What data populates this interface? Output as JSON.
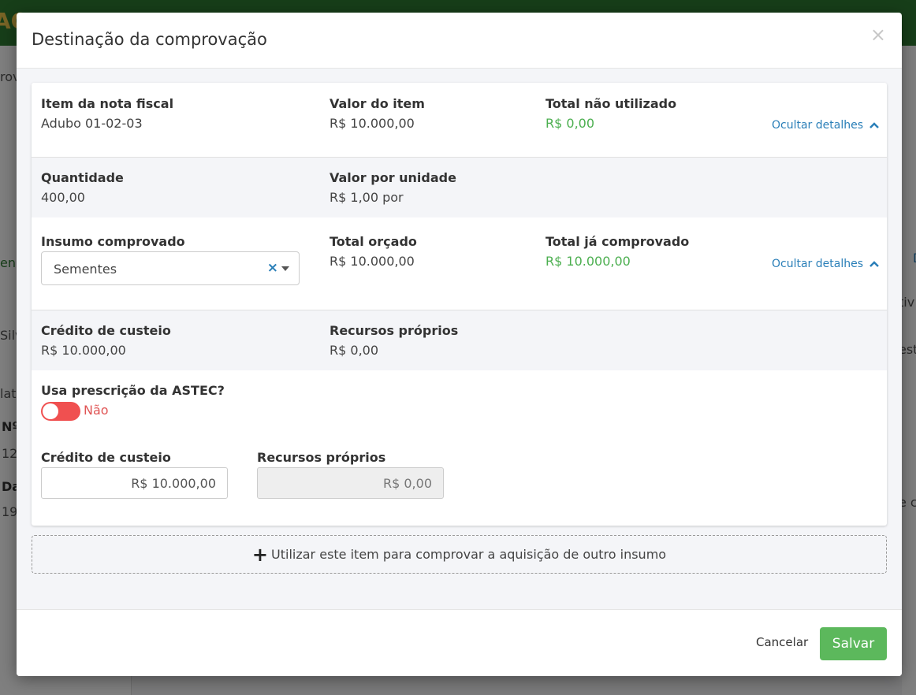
{
  "background": {
    "logo_fragment": "AC",
    "fragments": [
      "rov",
      "en",
      "Silv",
      "lat",
      "Nº",
      "12",
      "Da",
      "19",
      "tiv",
      "est",
      "e c",
      "D"
    ]
  },
  "modal": {
    "title": "Destinação da comprovação",
    "close_label": "×",
    "item": {
      "item_label": "Item da nota fiscal",
      "item_value": "Adubo 01-02-03",
      "valor_label": "Valor do item",
      "valor_value": "R$ 10.000,00",
      "total_nao_label": "Total não utilizado",
      "total_nao_value": "R$ 0,00",
      "toggle_label": "Ocultar detalhes"
    },
    "detalhes1": {
      "qtd_label": "Quantidade",
      "qtd_value": "400,00",
      "unit_label": "Valor por unidade",
      "unit_value": "R$ 1,00 por"
    },
    "insumo": {
      "label": "Insumo comprovado",
      "selected": "Sementes",
      "clear_icon": "×",
      "orcado_label": "Total orçado",
      "orcado_value": "R$ 10.000,00",
      "comprovado_label": "Total já comprovado",
      "comprovado_value": "R$ 10.000,00",
      "toggle_label": "Ocultar detalhes"
    },
    "detalhes2": {
      "credito_label": "Crédito de custeio",
      "credito_value": "R$ 10.000,00",
      "recursos_label": "Recursos próprios",
      "recursos_value": "R$ 0,00"
    },
    "astec": {
      "label": "Usa prescrição da ASTEC?",
      "toggle_text": "Não",
      "toggle_on": false
    },
    "inputs": {
      "credito_label": "Crédito de custeio",
      "credito_value": "R$ 10.000,00",
      "recursos_label": "Recursos próprios",
      "recursos_value": "R$ 0,00"
    },
    "add_item_label": "Utilizar este item para comprovar a aquisição de outro insumo",
    "footer": {
      "cancel_label": "Cancelar",
      "save_label": "Salvar"
    },
    "colors": {
      "accent_green": "#5cb85c",
      "value_green": "#4caf50",
      "link_blue": "#2a7fb8",
      "toggle_red": "#f05050"
    }
  }
}
